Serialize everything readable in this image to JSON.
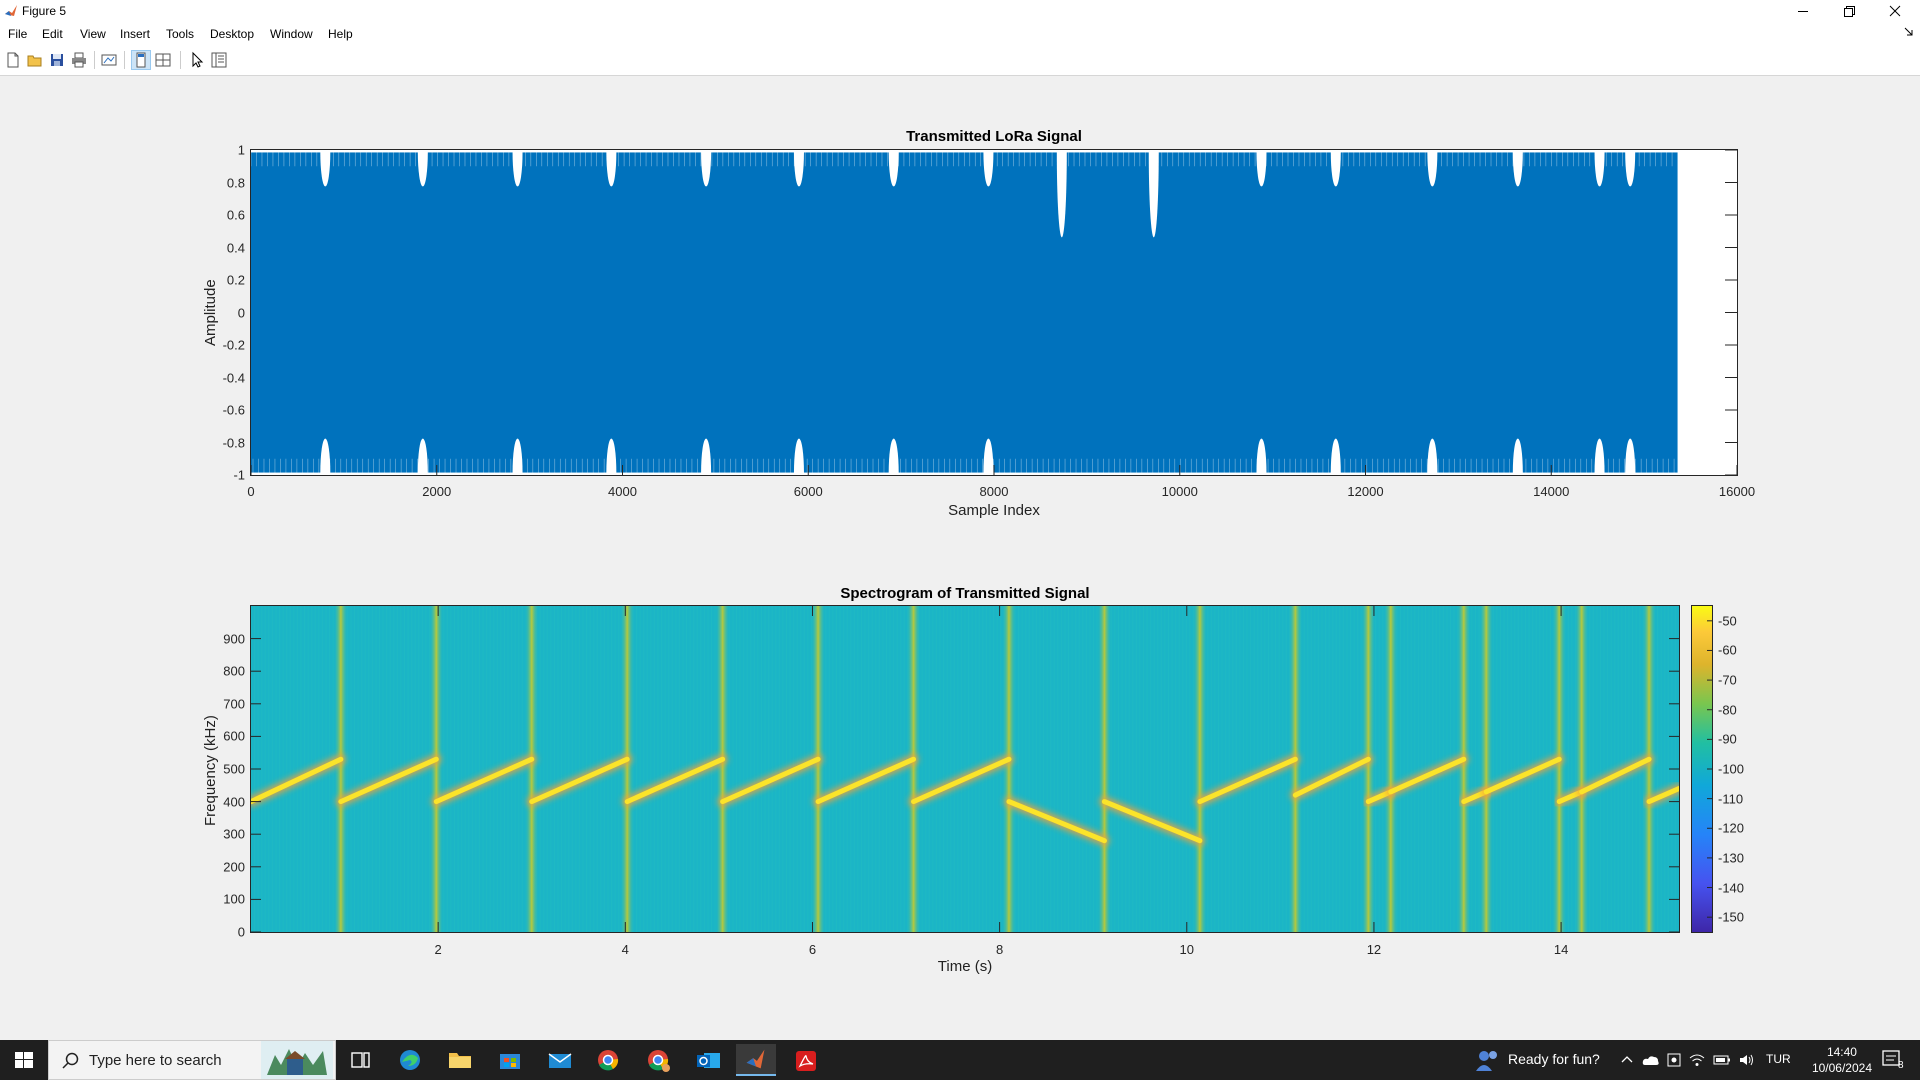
{
  "window": {
    "title": "Figure 5"
  },
  "menu": [
    "File",
    "Edit",
    "View",
    "Insert",
    "Tools",
    "Desktop",
    "Window",
    "Help"
  ],
  "toolbar": {
    "buttons": [
      "new-figure-icon",
      "open-file-icon",
      "save-icon",
      "print-icon",
      "link-plot-icon",
      "dock-figure-icon",
      "tile-icon",
      "pointer-icon",
      "property-inspector-icon"
    ]
  },
  "chart_data": [
    {
      "type": "line",
      "title": "Transmitted LoRa Signal",
      "xlabel": "Sample Index",
      "ylabel": "Amplitude",
      "xlim": [
        0,
        16000
      ],
      "ylim": [
        -1,
        1
      ],
      "x_ticks": [
        "0",
        "2000",
        "4000",
        "6000",
        "8000",
        "10000",
        "12000",
        "14000",
        "16000"
      ],
      "y_ticks": [
        "1",
        "0.8",
        "0.6",
        "0.4",
        "0.2",
        "0",
        "-0.2",
        "-0.4",
        "-0.6",
        "-0.8",
        "-1"
      ],
      "signal_end_sample": 15360,
      "symbol_boundaries": [
        800,
        1850,
        2870,
        3880,
        4900,
        5900,
        6920,
        7940,
        8730,
        9720,
        10880,
        11680,
        12720,
        13640,
        14520,
        14850
      ],
      "series_color": "#0072bd",
      "grid": false
    },
    {
      "type": "heatmap",
      "title": "Spectrogram of Transmitted Signal",
      "xlabel": "Time (s)",
      "ylabel": "Frequency (kHz)",
      "xlim": [
        0,
        15.26
      ],
      "ylim": [
        0,
        1000
      ],
      "x_ticks": [
        "2",
        "4",
        "6",
        "8",
        "10",
        "12",
        "14"
      ],
      "y_ticks": [
        "900",
        "800",
        "700",
        "600",
        "500",
        "400",
        "300",
        "200",
        "100",
        "0"
      ],
      "chirps": [
        {
          "t0": 0.0,
          "t1": 0.96,
          "f0": 400,
          "f1": 530,
          "dir": "up"
        },
        {
          "t0": 0.96,
          "t1": 1.98,
          "f0": 400,
          "f1": 530,
          "dir": "up"
        },
        {
          "t0": 1.98,
          "t1": 3.0,
          "f0": 400,
          "f1": 530,
          "dir": "up"
        },
        {
          "t0": 3.0,
          "t1": 4.02,
          "f0": 400,
          "f1": 530,
          "dir": "up"
        },
        {
          "t0": 4.02,
          "t1": 5.04,
          "f0": 400,
          "f1": 530,
          "dir": "up"
        },
        {
          "t0": 5.04,
          "t1": 6.06,
          "f0": 400,
          "f1": 530,
          "dir": "up"
        },
        {
          "t0": 6.06,
          "t1": 7.08,
          "f0": 400,
          "f1": 530,
          "dir": "up"
        },
        {
          "t0": 7.08,
          "t1": 8.1,
          "f0": 400,
          "f1": 530,
          "dir": "up"
        },
        {
          "t0": 8.1,
          "t1": 9.12,
          "f0": 400,
          "f1": 280,
          "dir": "down"
        },
        {
          "t0": 9.12,
          "t1": 10.14,
          "f0": 400,
          "f1": 280,
          "dir": "down"
        },
        {
          "t0": 10.14,
          "t1": 11.16,
          "f0": 400,
          "f1": 530,
          "dir": "up"
        },
        {
          "t0": 11.16,
          "t1": 11.94,
          "f0": 420,
          "f1": 530,
          "dir": "up"
        },
        {
          "t0": 11.94,
          "t1": 12.18,
          "f0": 400,
          "f1": 430,
          "dir": "up"
        },
        {
          "t0": 12.18,
          "t1": 12.96,
          "f0": 430,
          "f1": 530,
          "dir": "up"
        },
        {
          "t0": 12.96,
          "t1": 13.2,
          "f0": 400,
          "f1": 430,
          "dir": "up"
        },
        {
          "t0": 13.2,
          "t1": 13.98,
          "f0": 430,
          "f1": 530,
          "dir": "up"
        },
        {
          "t0": 13.98,
          "t1": 14.22,
          "f0": 400,
          "f1": 430,
          "dir": "up"
        },
        {
          "t0": 14.22,
          "t1": 14.94,
          "f0": 430,
          "f1": 530,
          "dir": "up"
        },
        {
          "t0": 14.94,
          "t1": 15.26,
          "f0": 400,
          "f1": 440,
          "dir": "up"
        }
      ],
      "vertical_bursts": [
        0.96,
        1.98,
        3.0,
        4.02,
        5.04,
        6.06,
        7.08,
        8.1,
        9.12,
        10.14,
        11.16,
        11.94,
        12.18,
        12.96,
        13.2,
        13.98,
        14.22,
        14.94
      ],
      "colorbar": {
        "range": [
          -155,
          -45
        ],
        "ticks": [
          "-50",
          "-60",
          "-70",
          "-80",
          "-90",
          "-100",
          "-110",
          "-120",
          "-130",
          "-140",
          "-150"
        ],
        "colormap": "parula"
      },
      "grid": false
    }
  ],
  "taskbar": {
    "search_placeholder": "Type here to search",
    "apps": [
      "task-view-icon",
      "edge-icon",
      "file-explorer-icon",
      "store-icon",
      "mail-icon",
      "chrome-icon",
      "chrome-profile-icon",
      "outlook-icon",
      "matlab-icon",
      "acrobat-icon"
    ],
    "active_app": "matlab-icon",
    "ready_text": "Ready for fun?",
    "language": "TUR",
    "time": "14:40",
    "date": "10/06/2024",
    "notification_count": "8"
  }
}
